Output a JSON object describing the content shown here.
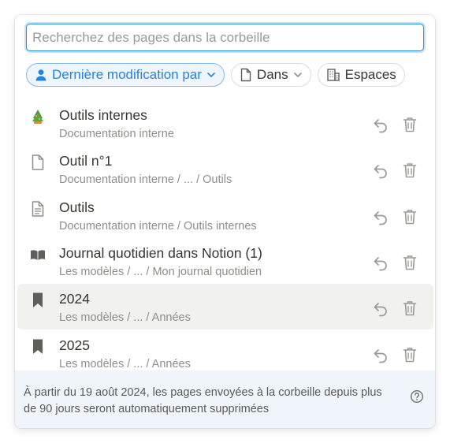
{
  "search": {
    "value": "",
    "placeholder": "Recherchez des pages dans la corbeille"
  },
  "filters": {
    "last_edited_by": "Dernière modification par",
    "in": "Dans",
    "spaces": "Espaces"
  },
  "items": [
    {
      "icon": "tree-emoji-icon",
      "title": "Outils internes",
      "path": "Documentation interne"
    },
    {
      "icon": "page-icon",
      "title": "Outil n°1",
      "path": "Documentation interne / ... / Outils"
    },
    {
      "icon": "page-text-icon",
      "title": "Outils",
      "path": "Documentation interne / Outils internes"
    },
    {
      "icon": "book-open-icon",
      "title": "Journal quotidien dans Notion (1)",
      "path": "Les modèles / ... / Mon journal quotidien"
    },
    {
      "icon": "bookmark-icon",
      "title": "2024",
      "path": "Les modèles / ... / Années",
      "hovered": true
    },
    {
      "icon": "bookmark-icon",
      "title": "2025",
      "path": "Les modèles / ... / Années"
    }
  ],
  "footer": {
    "message": "À partir du 19 août 2024, les pages envoyées à la corbeille depuis plus de 90 jours seront automatiquement supprimées"
  },
  "colors": {
    "accent": "#2383e2",
    "footer_bg": "#eff5fb",
    "hover_bg": "#f1f1ef"
  }
}
